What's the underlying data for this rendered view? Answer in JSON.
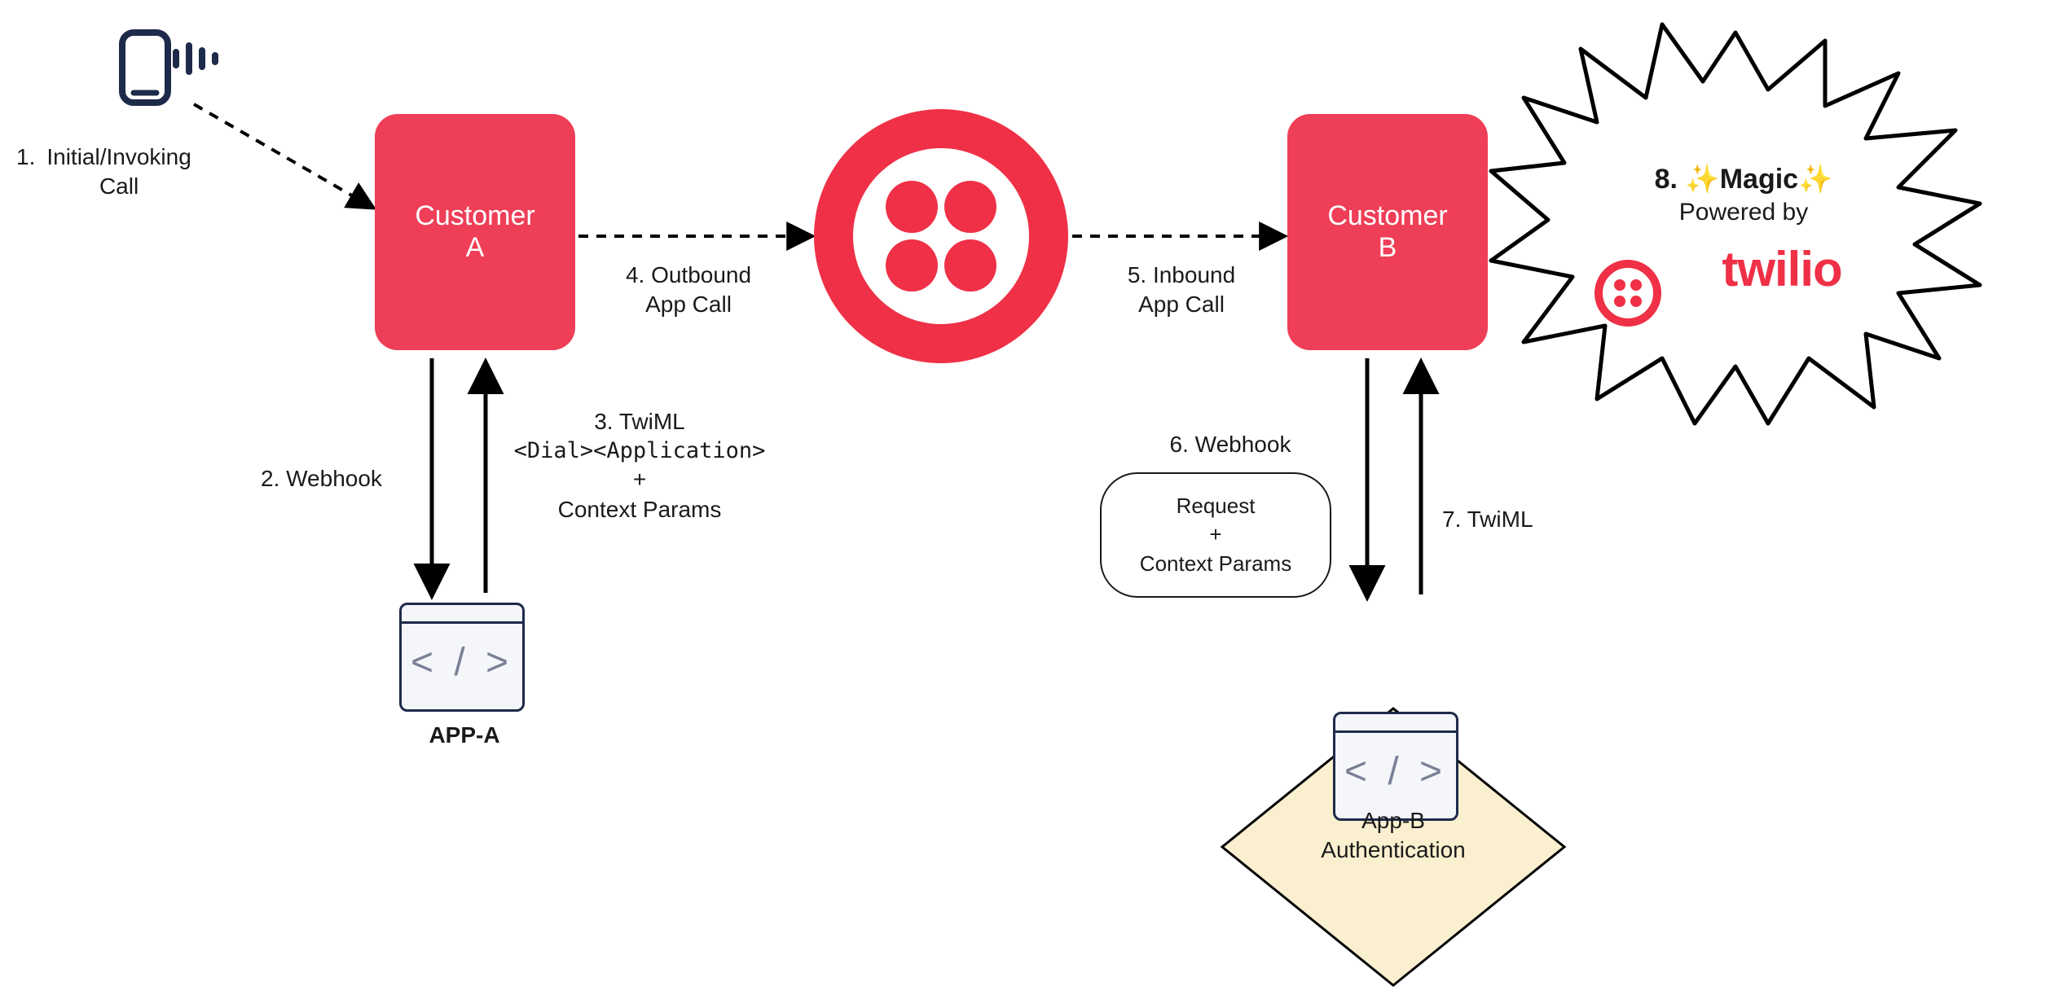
{
  "nodes": {
    "phone_icon": "phone-sound-icon",
    "customer_a": "Customer\nA",
    "customer_b": "Customer\nB",
    "twilio_center_icon": "twilio-logo-icon",
    "app_a_code_icon": "code-icon",
    "app_b_code_icon": "code-icon",
    "app_a_label": "APP-A",
    "diamond_line1": "App-B",
    "diamond_line2": "Authentication",
    "bubble_line1": "Request",
    "bubble_line2": "+",
    "bubble_line3": "Context Params",
    "magic_line1": "8. ✨Magic✨",
    "magic_line2": "Powered by",
    "twilio_word": "twilio",
    "twilio_small_icon": "twilio-logo-small-icon"
  },
  "labels": {
    "step1_num": "1.",
    "step1_line1": "Initial/Invoking",
    "step1_line2": "Call",
    "step2": "2. Webhook",
    "step3_line1": "3. TwiML",
    "step3_line2": "<Dial><Application>",
    "step3_line3": "+",
    "step3_line4": "Context Params",
    "step4_line1": "4. Outbound",
    "step4_line2": "App Call",
    "step5_line1": "5. Inbound",
    "step5_line2": "App Call",
    "step6": "6. Webhook",
    "step7": "7. TwiML"
  },
  "colors": {
    "twilio_red": "#ef3046",
    "node_red": "#ef3e57",
    "navy": "#1e2a4a",
    "diamond_fill": "#faefcf"
  }
}
